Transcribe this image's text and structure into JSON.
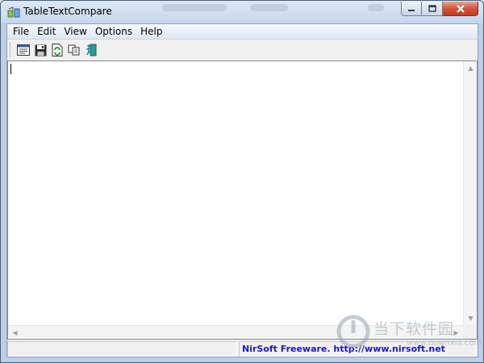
{
  "window": {
    "title": "TableTextCompare"
  },
  "menu": {
    "items": [
      {
        "label": "File"
      },
      {
        "label": "Edit"
      },
      {
        "label": "View"
      },
      {
        "label": "Options"
      },
      {
        "label": "Help"
      }
    ]
  },
  "toolbar": {
    "buttons": [
      {
        "icon": "properties-icon"
      },
      {
        "icon": "save-icon"
      },
      {
        "icon": "refresh-icon"
      },
      {
        "icon": "copy-icon"
      },
      {
        "icon": "exit-icon"
      }
    ]
  },
  "editor": {
    "content": ""
  },
  "statusbar": {
    "link_text": "NirSoft Freeware.  http://www.nirsoft.net"
  },
  "watermark": {
    "text": "当下软件园",
    "sub": "www.downxia.com"
  },
  "colors": {
    "status_link": "#1a1acc",
    "close_button": "#c23b22"
  }
}
